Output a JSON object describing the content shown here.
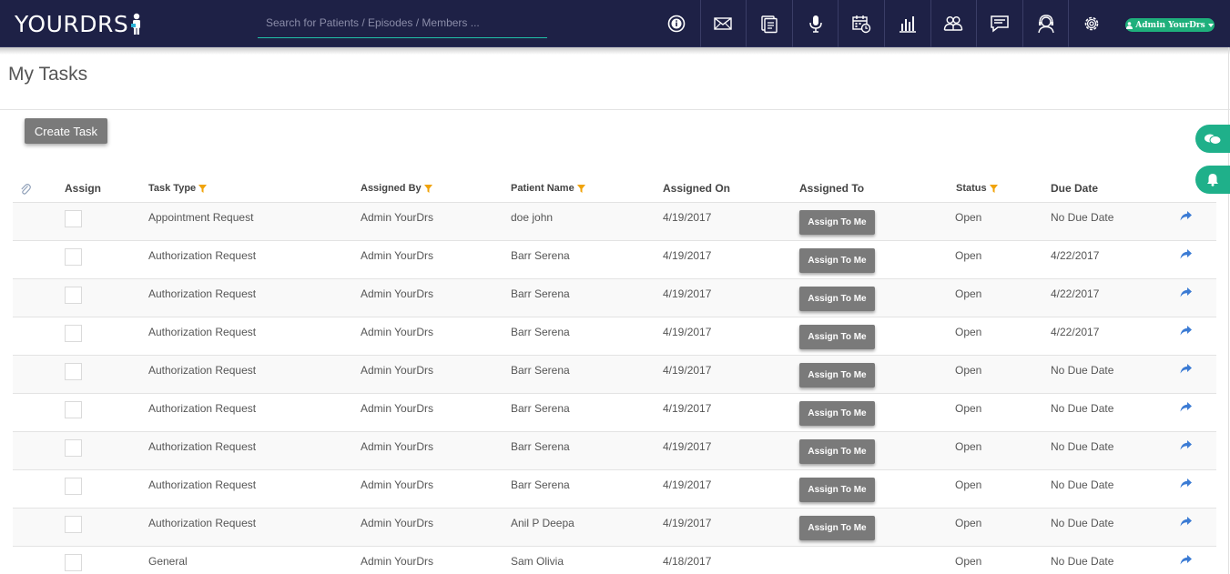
{
  "header": {
    "logo_text": "YOURDRS",
    "search_placeholder": "Search for Patients / Episodes / Members ...",
    "nav_icons": [
      "info-icon",
      "mail-icon",
      "documents-icon",
      "microphone-icon",
      "calendar-icon",
      "reports-chart-icon",
      "group-icon",
      "chat-icon",
      "support-icon",
      "settings-gear-icon"
    ],
    "user_label": "Admin YourDrs"
  },
  "page": {
    "title": "My Tasks",
    "create_task_label": "Create Task"
  },
  "colors": {
    "navbar": "#1e2146",
    "accent": "#1fb07c",
    "filter_icon": "#f0a30a",
    "share_icon": "#3b7bd4",
    "button_gray": "#7a7a7a"
  },
  "table": {
    "headers": {
      "assign": "Assign",
      "task_type": "Task Type",
      "assigned_by": "Assigned By",
      "patient_name": "Patient Name",
      "assigned_on": "Assigned On",
      "assigned_to": "Assigned To",
      "status": "Status",
      "due_date": "Due Date"
    },
    "assign_button_label": "Assign To Me",
    "rows": [
      {
        "task_type": "Appointment Request",
        "assigned_by": "Admin YourDrs",
        "patient_name": "doe john",
        "assigned_on": "4/19/2017",
        "status": "Open",
        "due_date": "No Due Date",
        "assign_button": true
      },
      {
        "task_type": "Authorization Request",
        "assigned_by": "Admin YourDrs",
        "patient_name": "Barr Serena",
        "assigned_on": "4/19/2017",
        "status": "Open",
        "due_date": "4/22/2017",
        "assign_button": true
      },
      {
        "task_type": "Authorization Request",
        "assigned_by": "Admin YourDrs",
        "patient_name": "Barr Serena",
        "assigned_on": "4/19/2017",
        "status": "Open",
        "due_date": "4/22/2017",
        "assign_button": true
      },
      {
        "task_type": "Authorization Request",
        "assigned_by": "Admin YourDrs",
        "patient_name": "Barr Serena",
        "assigned_on": "4/19/2017",
        "status": "Open",
        "due_date": "4/22/2017",
        "assign_button": true
      },
      {
        "task_type": "Authorization Request",
        "assigned_by": "Admin YourDrs",
        "patient_name": "Barr Serena",
        "assigned_on": "4/19/2017",
        "status": "Open",
        "due_date": "No Due Date",
        "assign_button": true
      },
      {
        "task_type": "Authorization Request",
        "assigned_by": "Admin YourDrs",
        "patient_name": "Barr Serena",
        "assigned_on": "4/19/2017",
        "status": "Open",
        "due_date": "No Due Date",
        "assign_button": true
      },
      {
        "task_type": "Authorization Request",
        "assigned_by": "Admin YourDrs",
        "patient_name": "Barr Serena",
        "assigned_on": "4/19/2017",
        "status": "Open",
        "due_date": "No Due Date",
        "assign_button": true
      },
      {
        "task_type": "Authorization Request",
        "assigned_by": "Admin YourDrs",
        "patient_name": "Barr Serena",
        "assigned_on": "4/19/2017",
        "status": "Open",
        "due_date": "No Due Date",
        "assign_button": true
      },
      {
        "task_type": "Authorization Request",
        "assigned_by": "Admin YourDrs",
        "patient_name": "Anil P Deepa",
        "assigned_on": "4/19/2017",
        "status": "Open",
        "due_date": "No Due Date",
        "assign_button": true
      },
      {
        "task_type": "General",
        "assigned_by": "Admin YourDrs",
        "patient_name": "Sam Olivia",
        "assigned_on": "4/18/2017",
        "status": "Open",
        "due_date": "No Due Date",
        "assign_button": false
      }
    ]
  }
}
